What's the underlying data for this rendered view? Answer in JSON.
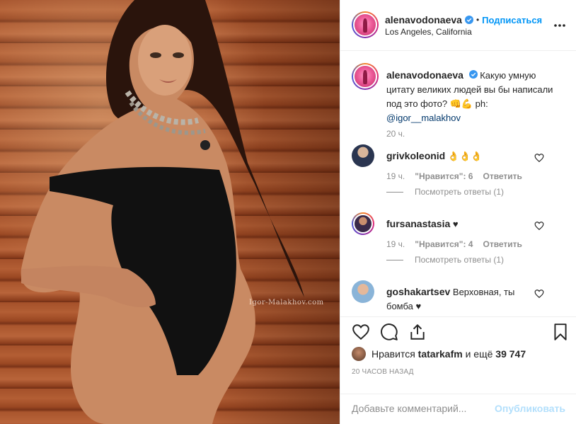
{
  "photo": {
    "watermark": "Igor-Malakhov.com"
  },
  "header": {
    "username": "alenavodonaeva",
    "separator": "•",
    "follow_label": "Подписаться",
    "location": "Los Angeles, California",
    "more_icon": "more-horizontal-icon"
  },
  "caption": {
    "username": "alenavodonaeva",
    "text": "Какую умную цитату великих людей вы бы написали под это фото? 👊💪 ph:",
    "mention": "@igor__malakhov",
    "time": "20 ч."
  },
  "comments": [
    {
      "username": "grivkoleonid",
      "text": "👌👌👌",
      "time": "19 ч.",
      "likes": "\"Нравится\": 6",
      "reply": "Ответить",
      "view_replies": "Посмотреть ответы (1)"
    },
    {
      "username": "fursanastasia",
      "text": "♥",
      "time": "19 ч.",
      "likes": "\"Нравится\": 4",
      "reply": "Ответить",
      "view_replies": "Посмотреть ответы (1)"
    },
    {
      "username": "goshakartsev",
      "text": "Верховная, ты бомба ♥"
    }
  ],
  "actions": {
    "likes_prefix": "Нравится",
    "likes_user": "tatarkafm",
    "likes_suffix": "и ещё",
    "likes_count": "39 747",
    "ago": "20 ЧАСОВ НАЗАД"
  },
  "add_comment": {
    "placeholder": "Добавьте комментарий...",
    "publish_label": "Опубликовать"
  },
  "colors": {
    "link_blue": "#0095f6",
    "publish_disabled": "#b2dffc",
    "muted": "#8e8e8e"
  }
}
